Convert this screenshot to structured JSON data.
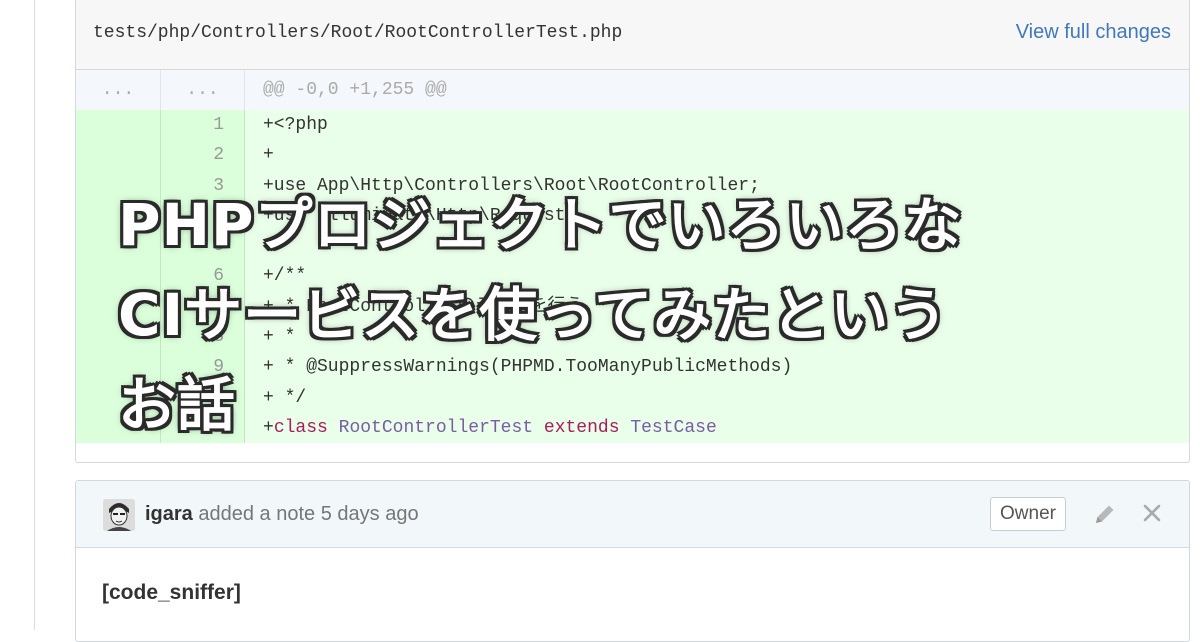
{
  "file": {
    "path": "tests/php/Controllers/Root/RootControllerTest.php",
    "view_full_changes": "View full changes"
  },
  "diff": {
    "hunk": {
      "left": "...",
      "right": "...",
      "text": "@@ -0,0 +1,255 @@"
    },
    "lines": [
      {
        "num": "1",
        "text": "+<?php"
      },
      {
        "num": "2",
        "text": "+"
      },
      {
        "num": "3",
        "text": "+use App\\Http\\Controllers\\Root\\RootController;"
      },
      {
        "num": "4",
        "text": "+use Illuminate\\Http\\Request;"
      },
      {
        "num": "5",
        "text": "+"
      },
      {
        "num": "6",
        "text": "+/**"
      },
      {
        "num": "7",
        "text": "+ * RootControllerのテストを行う."
      },
      {
        "num": "8",
        "text": "+ *"
      },
      {
        "num": "9",
        "text": "+ * @SuppressWarnings(PHPMD.TooManyPublicMethods)"
      },
      {
        "num": "10",
        "text": "+ */"
      },
      {
        "num": "11",
        "prefix": "+",
        "kw1": "class",
        "cls1": "RootControllerTest",
        "kw2": "extends",
        "cls2": "TestCase"
      }
    ]
  },
  "note": {
    "author": "igara",
    "action": "added a note 5 days ago",
    "badge": "Owner",
    "body": "[code_sniffer]",
    "icons": {
      "edit": "pencil-icon",
      "close": "close-icon",
      "avatar": "avatar-image"
    }
  },
  "overlay": {
    "lines": [
      "PHPプロジェクトでいろいろな",
      "CIサービスを使ってみたという",
      "お話"
    ]
  },
  "colors": {
    "added_bg": "#eaffea",
    "added_num_bg": "#dbffdb",
    "hunk_bg": "#f4f7fb",
    "link": "#4078c0",
    "keyword": "#a71d5d",
    "class_name": "#795da3"
  }
}
